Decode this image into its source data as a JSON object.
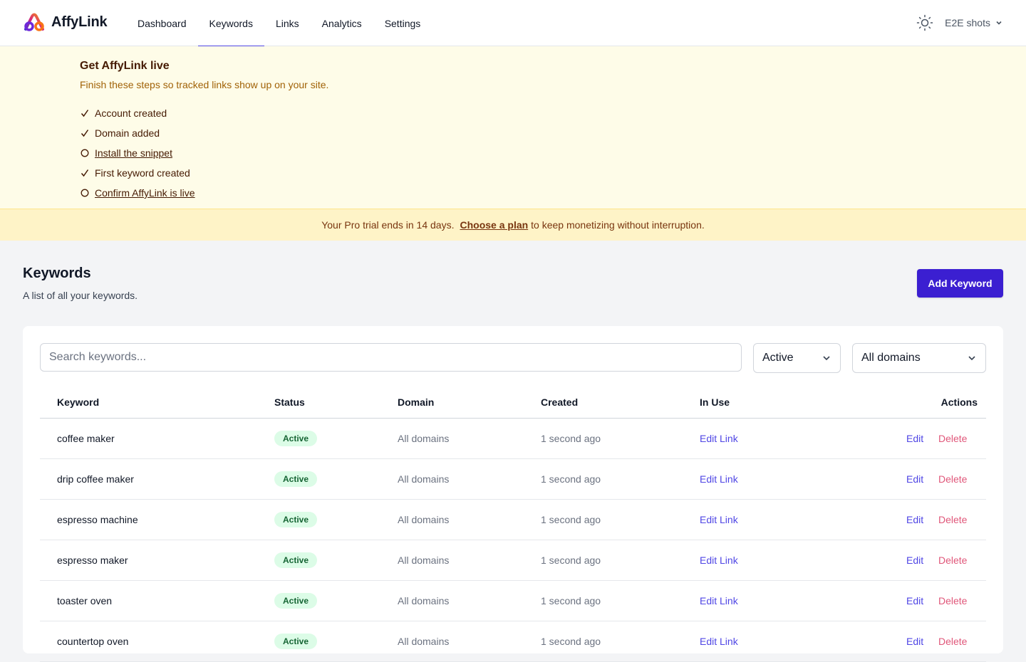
{
  "app": {
    "name": "AffyLink"
  },
  "nav": {
    "tabs": [
      {
        "label": "Dashboard"
      },
      {
        "label": "Keywords"
      },
      {
        "label": "Links"
      },
      {
        "label": "Analytics"
      },
      {
        "label": "Settings"
      }
    ],
    "active_tab": "Keywords",
    "account_label": "E2E shots"
  },
  "onboarding": {
    "title": "Get AffyLink live",
    "subtitle": "Finish these steps so tracked links show up on your site.",
    "steps": [
      {
        "label": "Account created",
        "done": true
      },
      {
        "label": "Domain added",
        "done": true
      },
      {
        "label": "Install the snippet",
        "done": false
      },
      {
        "label": "First keyword created",
        "done": true
      },
      {
        "label": "Confirm AffyLink is live",
        "done": false
      }
    ]
  },
  "trial": {
    "before": "Your Pro trial ends in 14 days.",
    "link": "Choose a plan",
    "after": "to keep monetizing without interruption."
  },
  "page": {
    "title": "Keywords",
    "subtitle": "A list of all your keywords.",
    "add_button": "Add Keyword"
  },
  "filters": {
    "search_placeholder": "Search keywords...",
    "status_value": "Active",
    "domain_value": "All domains"
  },
  "table": {
    "columns": [
      "Keyword",
      "Status",
      "Domain",
      "Created",
      "In Use",
      "Actions"
    ],
    "rows": [
      {
        "keyword": "coffee maker",
        "status": "Active",
        "domain": "All domains",
        "created": "1 second ago",
        "in_use": "Edit Link",
        "edit": "Edit",
        "delete": "Delete"
      },
      {
        "keyword": "drip coffee maker",
        "status": "Active",
        "domain": "All domains",
        "created": "1 second ago",
        "in_use": "Edit Link",
        "edit": "Edit",
        "delete": "Delete"
      },
      {
        "keyword": "espresso machine",
        "status": "Active",
        "domain": "All domains",
        "created": "1 second ago",
        "in_use": "Edit Link",
        "edit": "Edit",
        "delete": "Delete"
      },
      {
        "keyword": "espresso maker",
        "status": "Active",
        "domain": "All domains",
        "created": "1 second ago",
        "in_use": "Edit Link",
        "edit": "Edit",
        "delete": "Delete"
      },
      {
        "keyword": "toaster oven",
        "status": "Active",
        "domain": "All domains",
        "created": "1 second ago",
        "in_use": "Edit Link",
        "edit": "Edit",
        "delete": "Delete"
      },
      {
        "keyword": "countertop oven",
        "status": "Active",
        "domain": "All domains",
        "created": "1 second ago",
        "in_use": "Edit Link",
        "edit": "Edit",
        "delete": "Delete"
      }
    ]
  },
  "colors": {
    "accent": "#4f46e5",
    "button": "#3b1fd1",
    "onboarding_bg": "#fefce8",
    "trial_bg": "#fef3c7",
    "badge_bg": "#dcfce7",
    "badge_text": "#166534",
    "delete": "#e0577a"
  },
  "icons": [
    "affylink-logo",
    "sun-icon",
    "chevron-down-icon",
    "check-icon",
    "circle-icon"
  ]
}
